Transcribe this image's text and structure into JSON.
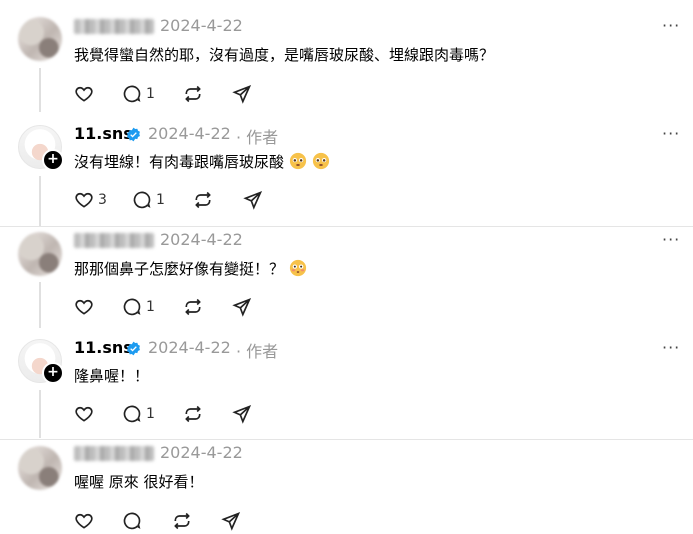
{
  "comments": [
    {
      "date": "2024-4-22",
      "text": "我覺得蠻自然的耶，沒有過度，是嘴唇玻尿酸、埋線跟肉毒嗎？",
      "like_count": "",
      "reply_count": "1"
    },
    {
      "username": "11.sns",
      "date": "2024-4-22",
      "author_tag": "作者",
      "text": "沒有埋線！有肉毒跟嘴唇玻尿酸",
      "like_count": "3",
      "reply_count": "1"
    },
    {
      "date": "2024-4-22",
      "text": "那那個鼻子怎麼好像有變挺！？",
      "like_count": "",
      "reply_count": "1"
    },
    {
      "username": "11.sns",
      "date": "2024-4-22",
      "author_tag": "作者",
      "text": "隆鼻喔！！",
      "like_count": "",
      "reply_count": "1"
    },
    {
      "date": "2024-4-22",
      "text": "喔喔 原來 很好看！",
      "like_count": "",
      "reply_count": ""
    }
  ],
  "icons": {
    "like": "heart-icon",
    "reply": "comment-icon",
    "repost": "repost-icon",
    "share": "share-icon",
    "more": "more-icon",
    "verified": "verified-badge-icon",
    "follow": "plus-icon"
  },
  "colors": {
    "verified": "#1d9bf0",
    "muted": "#999999"
  }
}
